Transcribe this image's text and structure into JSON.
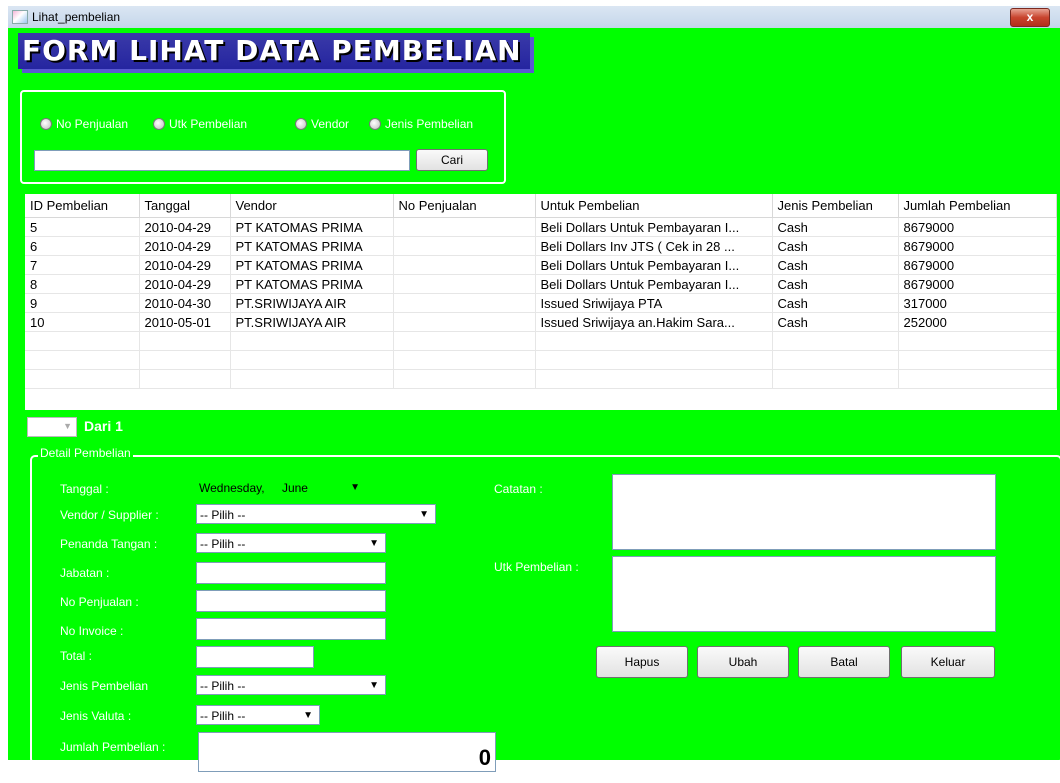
{
  "window": {
    "title": "Lihat_pembelian",
    "close_label": "x"
  },
  "heading": "FORM LIHAT DATA PEMBELIAN",
  "search": {
    "options": [
      "No Penjualan",
      "Utk Pembelian",
      "Vendor",
      "Jenis Pembelian"
    ],
    "query": "",
    "button_label": "Cari"
  },
  "grid": {
    "columns": [
      "ID Pembelian",
      "Tanggal",
      "Vendor",
      "No Penjualan",
      "Untuk Pembelian",
      "Jenis Pembelian",
      "Jumlah Pembelian"
    ],
    "rows": [
      [
        "5",
        "2010-04-29",
        "PT KATOMAS PRIMA",
        "",
        "Beli Dollars Untuk Pembayaran I...",
        "Cash",
        "8679000"
      ],
      [
        "6",
        "2010-04-29",
        "PT KATOMAS PRIMA",
        "",
        "Beli Dollars Inv JTS ( Cek in 28 ...",
        "Cash",
        "8679000"
      ],
      [
        "7",
        "2010-04-29",
        "PT KATOMAS PRIMA",
        "",
        "Beli Dollars Untuk Pembayaran I...",
        "Cash",
        "8679000"
      ],
      [
        "8",
        "2010-04-29",
        "PT KATOMAS PRIMA",
        "",
        "Beli Dollars Untuk Pembayaran I...",
        "Cash",
        "8679000"
      ],
      [
        "9",
        "2010-04-30",
        "PT.SRIWIJAYA AIR",
        "",
        "Issued Sriwijaya PTA",
        "Cash",
        "317000"
      ],
      [
        "10",
        "2010-05-01",
        "PT.SRIWIJAYA AIR",
        "",
        "Issued Sriwijaya an.Hakim Sara...",
        "Cash",
        "252000"
      ]
    ]
  },
  "pager": {
    "page": "",
    "of_label": "Dari 1"
  },
  "detail": {
    "legend": "Detail Pembelian",
    "labels": {
      "tanggal": "Tanggal :",
      "vendor": "Vendor / Supplier :",
      "penanda": "Penanda Tangan :",
      "jabatan": "Jabatan :",
      "no_penjualan": "No Penjualan :",
      "no_invoice": "No Invoice :",
      "total": "Total :",
      "jenis_pembelian": "Jenis Pembelian",
      "jenis_valuta": "Jenis Valuta :",
      "jumlah_pembelian": "Jumlah Pembelian :",
      "catatan": "Catatan :",
      "utk_pembelian": "Utk Pembelian :"
    },
    "tanggal_day": "Wednesday,",
    "tanggal_month": "June",
    "vendor_value": "-- Pilih --",
    "penanda_value": "-- Pilih --",
    "jenis_pembelian_value": "-- Pilih --",
    "jenis_valuta_value": "-- Pilih --",
    "jumlah_value": "0"
  },
  "buttons": {
    "hapus": "Hapus",
    "ubah": "Ubah",
    "batal": "Batal",
    "keluar": "Keluar"
  }
}
